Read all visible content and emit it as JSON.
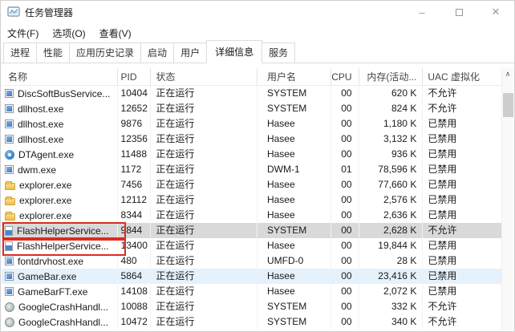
{
  "window": {
    "title": "任务管理器",
    "controls": {
      "minimize": "–",
      "close": "✕"
    }
  },
  "menu": {
    "items": [
      {
        "label": "文件(F)"
      },
      {
        "label": "选项(O)"
      },
      {
        "label": "查看(V)"
      }
    ]
  },
  "tabs": [
    {
      "label": "进程"
    },
    {
      "label": "性能"
    },
    {
      "label": "应用历史记录"
    },
    {
      "label": "启动"
    },
    {
      "label": "用户"
    },
    {
      "label": "详细信息",
      "active": true
    },
    {
      "label": "服务"
    }
  ],
  "table": {
    "columns": [
      {
        "key": "name",
        "label": "名称",
        "sorted": "ascending"
      },
      {
        "key": "pid",
        "label": "PID"
      },
      {
        "key": "status",
        "label": "状态"
      },
      {
        "key": "user",
        "label": "用户名"
      },
      {
        "key": "cpu",
        "label": "CPU"
      },
      {
        "key": "mem",
        "label": "内存(活动..."
      },
      {
        "key": "uac",
        "label": "UAC 虚拟化"
      }
    ],
    "rows": [
      {
        "icon": "app",
        "name": "DiscSoftBusService...",
        "pid": "10404",
        "status": "正在运行",
        "user": "SYSTEM",
        "cpu": "00",
        "mem": "620 K",
        "uac": "不允许"
      },
      {
        "icon": "app",
        "name": "dllhost.exe",
        "pid": "12652",
        "status": "正在运行",
        "user": "SYSTEM",
        "cpu": "00",
        "mem": "824 K",
        "uac": "不允许"
      },
      {
        "icon": "app",
        "name": "dllhost.exe",
        "pid": "9876",
        "status": "正在运行",
        "user": "Hasee",
        "cpu": "00",
        "mem": "1,180 K",
        "uac": "已禁用"
      },
      {
        "icon": "app",
        "name": "dllhost.exe",
        "pid": "12356",
        "status": "正在运行",
        "user": "Hasee",
        "cpu": "00",
        "mem": "3,132 K",
        "uac": "已禁用"
      },
      {
        "icon": "dt",
        "name": "DTAgent.exe",
        "pid": "11488",
        "status": "正在运行",
        "user": "Hasee",
        "cpu": "00",
        "mem": "936 K",
        "uac": "已禁用"
      },
      {
        "icon": "app",
        "name": "dwm.exe",
        "pid": "1172",
        "status": "正在运行",
        "user": "DWM-1",
        "cpu": "01",
        "mem": "78,596 K",
        "uac": "已禁用"
      },
      {
        "icon": "folder",
        "name": "explorer.exe",
        "pid": "7456",
        "status": "正在运行",
        "user": "Hasee",
        "cpu": "00",
        "mem": "77,660 K",
        "uac": "已禁用"
      },
      {
        "icon": "folder",
        "name": "explorer.exe",
        "pid": "12112",
        "status": "正在运行",
        "user": "Hasee",
        "cpu": "00",
        "mem": "2,576 K",
        "uac": "已禁用"
      },
      {
        "icon": "folder",
        "name": "explorer.exe",
        "pid": "8344",
        "status": "正在运行",
        "user": "Hasee",
        "cpu": "00",
        "mem": "2,636 K",
        "uac": "已禁用"
      },
      {
        "icon": "flash",
        "name": "FlashHelperService...",
        "pid": "9844",
        "status": "正在运行",
        "user": "SYSTEM",
        "cpu": "00",
        "mem": "2,628 K",
        "uac": "不允许",
        "selected": true,
        "annotated": true
      },
      {
        "icon": "flash",
        "name": "FlashHelperService...",
        "pid": "13400",
        "status": "正在运行",
        "user": "Hasee",
        "cpu": "00",
        "mem": "19,844 K",
        "uac": "已禁用",
        "annotated": true
      },
      {
        "icon": "app",
        "name": "fontdrvhost.exe",
        "pid": "480",
        "status": "正在运行",
        "user": "UMFD-0",
        "cpu": "00",
        "mem": "28 K",
        "uac": "已禁用"
      },
      {
        "icon": "app",
        "name": "GameBar.exe",
        "pid": "5864",
        "status": "正在运行",
        "user": "Hasee",
        "cpu": "00",
        "mem": "23,416 K",
        "uac": "已禁用",
        "hover": true
      },
      {
        "icon": "app",
        "name": "GameBarFT.exe",
        "pid": "14108",
        "status": "正在运行",
        "user": "Hasee",
        "cpu": "00",
        "mem": "2,072 K",
        "uac": "已禁用"
      },
      {
        "icon": "gch",
        "name": "GoogleCrashHandl...",
        "pid": "10088",
        "status": "正在运行",
        "user": "SYSTEM",
        "cpu": "00",
        "mem": "332 K",
        "uac": "不允许"
      },
      {
        "icon": "gch",
        "name": "GoogleCrashHandl...",
        "pid": "10472",
        "status": "正在运行",
        "user": "SYSTEM",
        "cpu": "00",
        "mem": "340 K",
        "uac": "不允许"
      }
    ]
  },
  "scrollbar": {
    "up_glyph": "∧"
  },
  "sort_glyph": "ˆ",
  "colors": {
    "selected_row": "#d9d9d9",
    "hover_row": "#e5f1fb",
    "annotation_red": "#dd2b20",
    "icon_blue": "#3a6db5",
    "folder_yellow": "#edbe4e"
  }
}
